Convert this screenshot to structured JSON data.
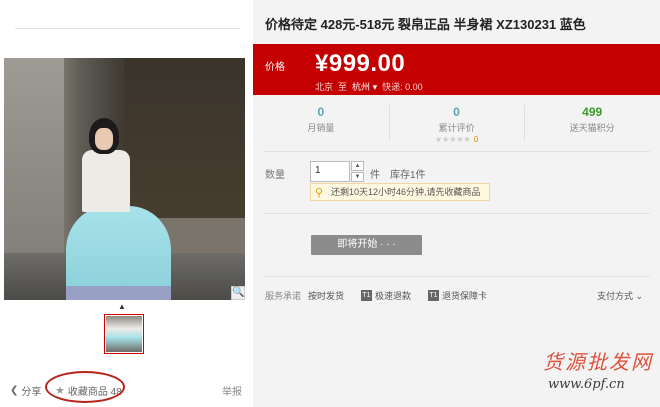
{
  "product": {
    "title": "价格待定 428元-518元 裂帛正品 半身裙 XZ130231 蓝色"
  },
  "price": {
    "label": "价格",
    "value": "¥999.00",
    "ship_from": "北京",
    "ship_to_word": "至",
    "ship_city": "杭州",
    "ship_fee": "快递: 0.00"
  },
  "stats": [
    {
      "value": "0",
      "label": "月销量"
    },
    {
      "value": "0",
      "label": "累计评价",
      "stars": "★★★★★",
      "score": "0"
    },
    {
      "value": "499",
      "label": "送天猫积分"
    }
  ],
  "quantity": {
    "label": "数量",
    "value": "1",
    "unit": "件",
    "stock": "库存1件",
    "notice": "还剩10天12小时46分钟,请先收藏商品"
  },
  "buy_button": "即将开始 · · ·",
  "services": {
    "label": "服务承诺",
    "items": [
      {
        "text": "按时发货",
        "badge": ""
      },
      {
        "text": "极速退款",
        "badge": "T1"
      },
      {
        "text": "退货保障卡",
        "badge": "T1"
      }
    ],
    "payment": "支付方式 ⌄"
  },
  "left": {
    "share": "分享",
    "favorite": "收藏商品 48",
    "report": "举报",
    "zoom_icon": "magnifier-icon"
  },
  "watermark": {
    "cn": "货源批发网",
    "url": "www.6pf.cn"
  },
  "colors": {
    "price_bg": "#c40000",
    "accent_blue": "#5ba4b1",
    "accent_green": "#3c9b2b"
  }
}
